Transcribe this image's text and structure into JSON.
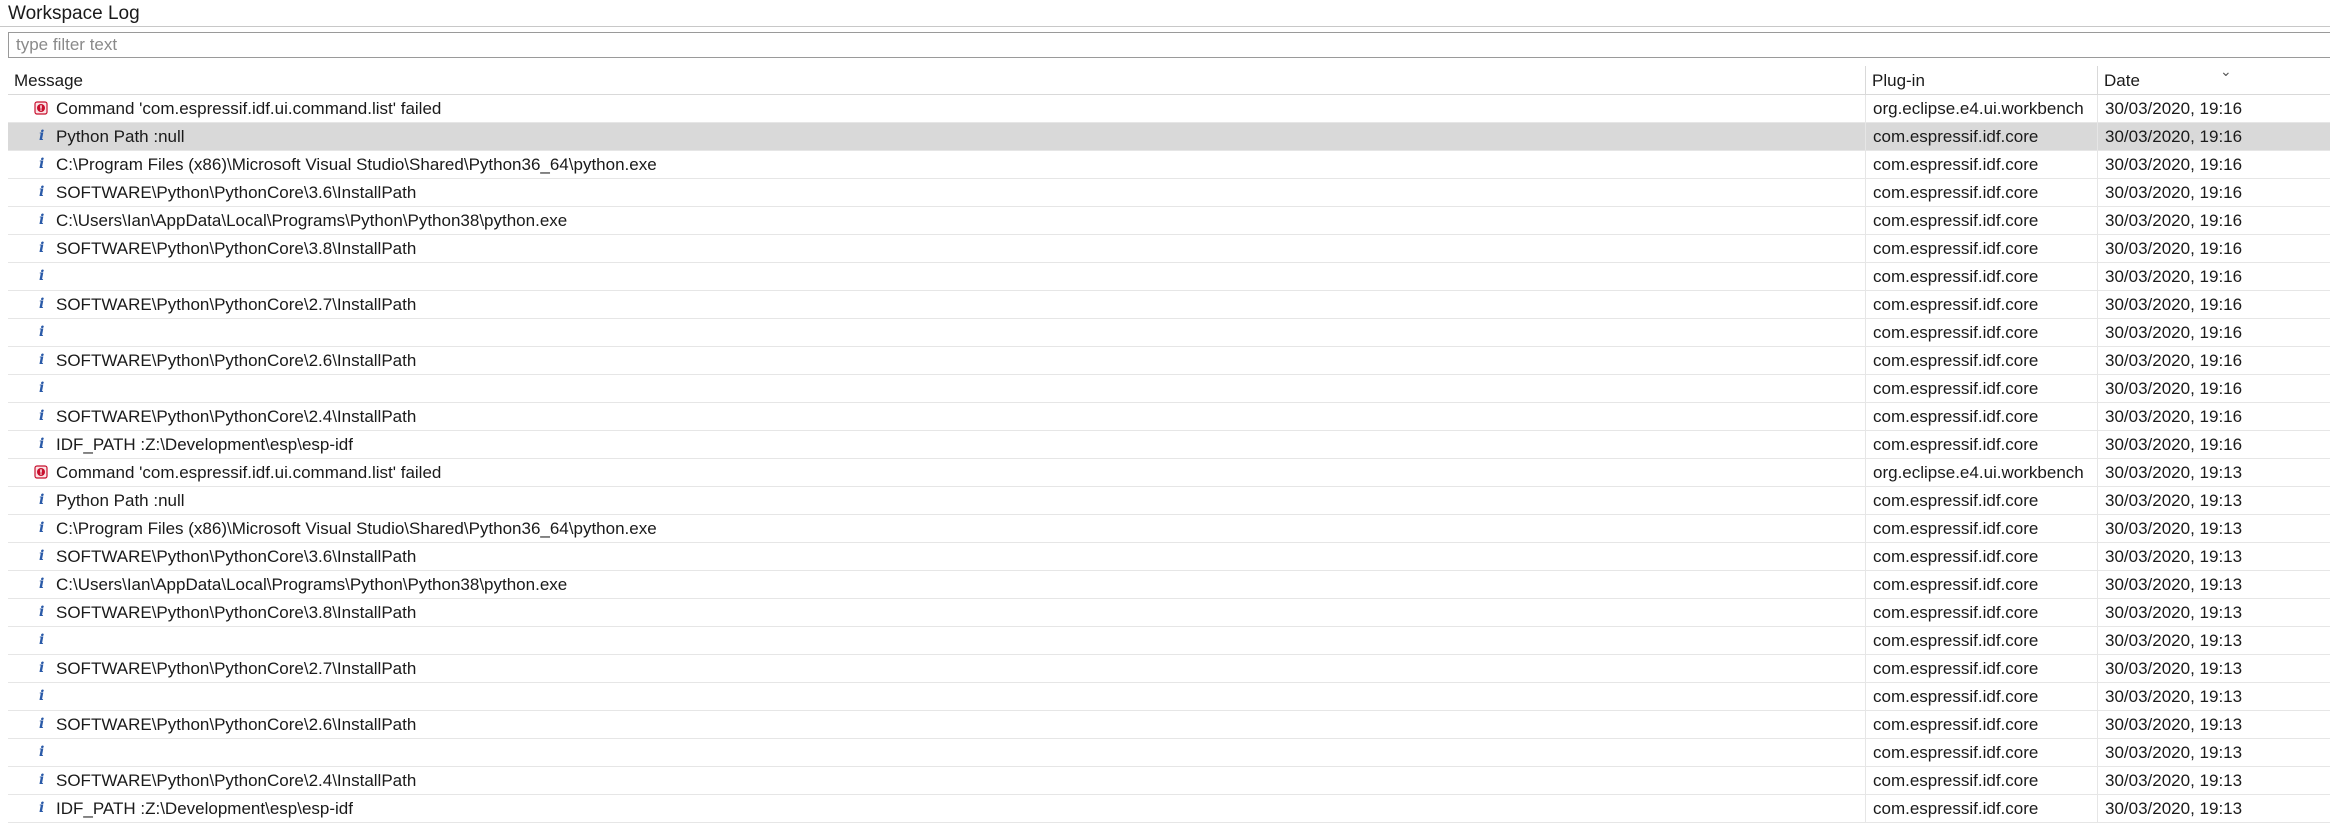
{
  "window": {
    "title": "Workspace Log"
  },
  "filter": {
    "placeholder": "type filter text"
  },
  "columns": {
    "message": "Message",
    "plugin": "Plug-in",
    "date": "Date"
  },
  "colors": {
    "error": "#c8102e",
    "info": "#2a5aa8",
    "selected_row": "#d9d9d9"
  },
  "selected_row_index": 1,
  "rows": [
    {
      "icon": "error-icon",
      "message": "Command 'com.espressif.idf.ui.command.list' failed",
      "plugin": "org.eclipse.e4.ui.workbench",
      "date": "30/03/2020, 19:16"
    },
    {
      "icon": "info-icon",
      "message": "Python Path :null",
      "plugin": "com.espressif.idf.core",
      "date": "30/03/2020, 19:16"
    },
    {
      "icon": "info-icon",
      "message": "C:\\Program Files (x86)\\Microsoft Visual Studio\\Shared\\Python36_64\\python.exe",
      "plugin": "com.espressif.idf.core",
      "date": "30/03/2020, 19:16"
    },
    {
      "icon": "info-icon",
      "message": "SOFTWARE\\Python\\PythonCore\\3.6\\InstallPath",
      "plugin": "com.espressif.idf.core",
      "date": "30/03/2020, 19:16"
    },
    {
      "icon": "info-icon",
      "message": "C:\\Users\\Ian\\AppData\\Local\\Programs\\Python\\Python38\\python.exe",
      "plugin": "com.espressif.idf.core",
      "date": "30/03/2020, 19:16"
    },
    {
      "icon": "info-icon",
      "message": "SOFTWARE\\Python\\PythonCore\\3.8\\InstallPath",
      "plugin": "com.espressif.idf.core",
      "date": "30/03/2020, 19:16"
    },
    {
      "icon": "info-icon",
      "message": "",
      "plugin": "com.espressif.idf.core",
      "date": "30/03/2020, 19:16"
    },
    {
      "icon": "info-icon",
      "message": "SOFTWARE\\Python\\PythonCore\\2.7\\InstallPath",
      "plugin": "com.espressif.idf.core",
      "date": "30/03/2020, 19:16"
    },
    {
      "icon": "info-icon",
      "message": "",
      "plugin": "com.espressif.idf.core",
      "date": "30/03/2020, 19:16"
    },
    {
      "icon": "info-icon",
      "message": "SOFTWARE\\Python\\PythonCore\\2.6\\InstallPath",
      "plugin": "com.espressif.idf.core",
      "date": "30/03/2020, 19:16"
    },
    {
      "icon": "info-icon",
      "message": "",
      "plugin": "com.espressif.idf.core",
      "date": "30/03/2020, 19:16"
    },
    {
      "icon": "info-icon",
      "message": "SOFTWARE\\Python\\PythonCore\\2.4\\InstallPath",
      "plugin": "com.espressif.idf.core",
      "date": "30/03/2020, 19:16"
    },
    {
      "icon": "info-icon",
      "message": "IDF_PATH :Z:\\Development\\esp\\esp-idf",
      "plugin": "com.espressif.idf.core",
      "date": "30/03/2020, 19:16"
    },
    {
      "icon": "error-icon",
      "message": "Command 'com.espressif.idf.ui.command.list' failed",
      "plugin": "org.eclipse.e4.ui.workbench",
      "date": "30/03/2020, 19:13"
    },
    {
      "icon": "info-icon",
      "message": "Python Path :null",
      "plugin": "com.espressif.idf.core",
      "date": "30/03/2020, 19:13"
    },
    {
      "icon": "info-icon",
      "message": "C:\\Program Files (x86)\\Microsoft Visual Studio\\Shared\\Python36_64\\python.exe",
      "plugin": "com.espressif.idf.core",
      "date": "30/03/2020, 19:13"
    },
    {
      "icon": "info-icon",
      "message": "SOFTWARE\\Python\\PythonCore\\3.6\\InstallPath",
      "plugin": "com.espressif.idf.core",
      "date": "30/03/2020, 19:13"
    },
    {
      "icon": "info-icon",
      "message": "C:\\Users\\Ian\\AppData\\Local\\Programs\\Python\\Python38\\python.exe",
      "plugin": "com.espressif.idf.core",
      "date": "30/03/2020, 19:13"
    },
    {
      "icon": "info-icon",
      "message": "SOFTWARE\\Python\\PythonCore\\3.8\\InstallPath",
      "plugin": "com.espressif.idf.core",
      "date": "30/03/2020, 19:13"
    },
    {
      "icon": "info-icon",
      "message": "",
      "plugin": "com.espressif.idf.core",
      "date": "30/03/2020, 19:13"
    },
    {
      "icon": "info-icon",
      "message": "SOFTWARE\\Python\\PythonCore\\2.7\\InstallPath",
      "plugin": "com.espressif.idf.core",
      "date": "30/03/2020, 19:13"
    },
    {
      "icon": "info-icon",
      "message": "",
      "plugin": "com.espressif.idf.core",
      "date": "30/03/2020, 19:13"
    },
    {
      "icon": "info-icon",
      "message": "SOFTWARE\\Python\\PythonCore\\2.6\\InstallPath",
      "plugin": "com.espressif.idf.core",
      "date": "30/03/2020, 19:13"
    },
    {
      "icon": "info-icon",
      "message": "",
      "plugin": "com.espressif.idf.core",
      "date": "30/03/2020, 19:13"
    },
    {
      "icon": "info-icon",
      "message": "SOFTWARE\\Python\\PythonCore\\2.4\\InstallPath",
      "plugin": "com.espressif.idf.core",
      "date": "30/03/2020, 19:13"
    },
    {
      "icon": "info-icon",
      "message": "IDF_PATH :Z:\\Development\\esp\\esp-idf",
      "plugin": "com.espressif.idf.core",
      "date": "30/03/2020, 19:13"
    }
  ]
}
